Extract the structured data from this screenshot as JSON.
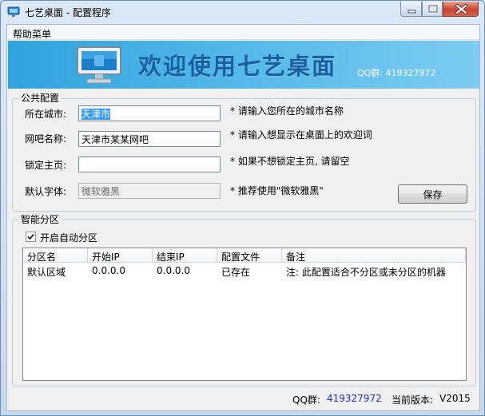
{
  "window": {
    "title": "七艺桌面 - 配置程序"
  },
  "menu": {
    "help": "帮助菜单"
  },
  "banner": {
    "title": "欢迎使用七艺桌面",
    "qq": "QQ群: 419327972"
  },
  "public_config": {
    "legend": "公共配置",
    "city_label": "所在城市:",
    "city_value": "天津市",
    "city_hint": "* 请输入您所在的城市名称",
    "netbar_label": "网吧名称:",
    "netbar_value": "天津市某某网吧",
    "netbar_hint": "* 请输入想显示在桌面上的欢迎词",
    "homepage_label": "锁定主页:",
    "homepage_value": "",
    "homepage_hint": "* 如果不想锁定主页, 请留空",
    "font_label": "默认字体:",
    "font_value": "微软雅黑",
    "font_hint": "* 推荐使用\"微软雅黑\"",
    "save_label": "保存"
  },
  "smart_partition": {
    "legend": "智能分区",
    "auto_label": "开启自动分区",
    "auto_checked": true,
    "columns": [
      "分区名",
      "开始IP",
      "结束IP",
      "配置文件",
      "备注"
    ],
    "rows": [
      [
        "默认区域",
        "0.0.0.0",
        "0.0.0.0",
        "已存在",
        "注: 此配置适合不分区或未分区的机器"
      ]
    ]
  },
  "status_bar": {
    "qq_label": "QQ群:",
    "qq_number": "419327972",
    "version_label": "当前版本:",
    "version_value": "V2015"
  },
  "colors": {
    "banner_start": "#2fa3dd",
    "banner_end": "#7cccf1",
    "banner_title": "#1a5fa0",
    "qq_number": "#1d2bd2",
    "selection": "#3399ff"
  }
}
